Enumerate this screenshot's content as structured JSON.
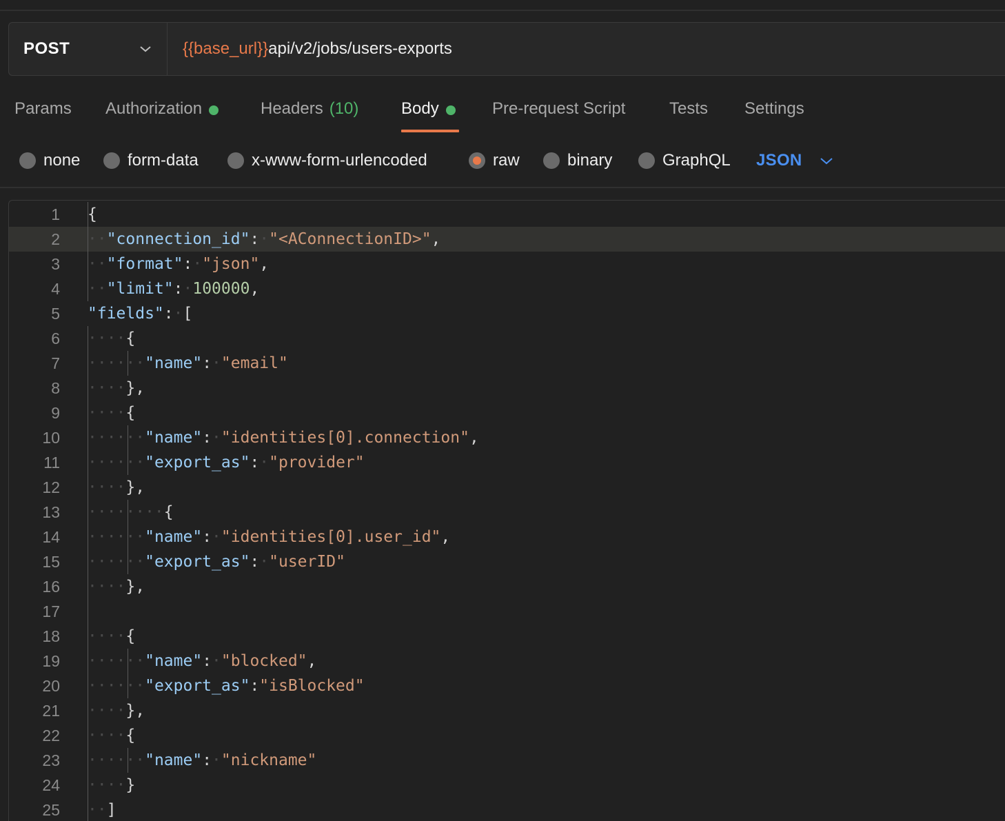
{
  "request": {
    "method": "POST",
    "url_variable": "{{base_url}}",
    "url_path": "api/v2/jobs/users-exports"
  },
  "tabs": [
    {
      "label": "Params"
    },
    {
      "label": "Authorization",
      "indicator": true
    },
    {
      "label": "Headers",
      "count": "(10)"
    },
    {
      "label": "Body",
      "indicator": true,
      "active": true
    },
    {
      "label": "Pre-request Script"
    },
    {
      "label": "Tests"
    },
    {
      "label": "Settings"
    }
  ],
  "body_types": [
    {
      "label": "none"
    },
    {
      "label": "form-data"
    },
    {
      "label": "x-www-form-urlencoded"
    },
    {
      "label": "raw",
      "selected": true
    },
    {
      "label": "binary"
    },
    {
      "label": "GraphQL"
    }
  ],
  "language": "JSON",
  "colors": {
    "accent": "#e8794a",
    "indicator_green": "#4fb469",
    "language_blue": "#4a8ff0",
    "json_key": "#9ccdf5",
    "json_string": "#d19a7a",
    "json_number": "#b5cea8"
  },
  "editor": {
    "lines": [
      {
        "n": "1",
        "text": "{"
      },
      {
        "n": "2",
        "text": "  \"connection_id\": \"<AConnectionID>\","
      },
      {
        "n": "3",
        "text": "  \"format\": \"json\","
      },
      {
        "n": "4",
        "text": "  \"limit\": 100000,"
      },
      {
        "n": "5",
        "text": "\"fields\": ["
      },
      {
        "n": "6",
        "text": "    {"
      },
      {
        "n": "7",
        "text": "      \"name\": \"email\""
      },
      {
        "n": "8",
        "text": "    },"
      },
      {
        "n": "9",
        "text": "    {"
      },
      {
        "n": "10",
        "text": "      \"name\": \"identities[0].connection\","
      },
      {
        "n": "11",
        "text": "      \"export_as\": \"provider\""
      },
      {
        "n": "12",
        "text": "    },"
      },
      {
        "n": "13",
        "text": "        {"
      },
      {
        "n": "14",
        "text": "      \"name\": \"identities[0].user_id\","
      },
      {
        "n": "15",
        "text": "      \"export_as\": \"userID\""
      },
      {
        "n": "16",
        "text": "    },"
      },
      {
        "n": "17",
        "text": ""
      },
      {
        "n": "18",
        "text": "    {"
      },
      {
        "n": "19",
        "text": "      \"name\": \"blocked\","
      },
      {
        "n": "20",
        "text": "      \"export_as\":\"isBlocked\""
      },
      {
        "n": "21",
        "text": "    },"
      },
      {
        "n": "22",
        "text": "    {"
      },
      {
        "n": "23",
        "text": "      \"name\": \"nickname\""
      },
      {
        "n": "24",
        "text": "    }"
      },
      {
        "n": "25",
        "text": "  ]"
      }
    ],
    "highlighted_line": "2"
  }
}
